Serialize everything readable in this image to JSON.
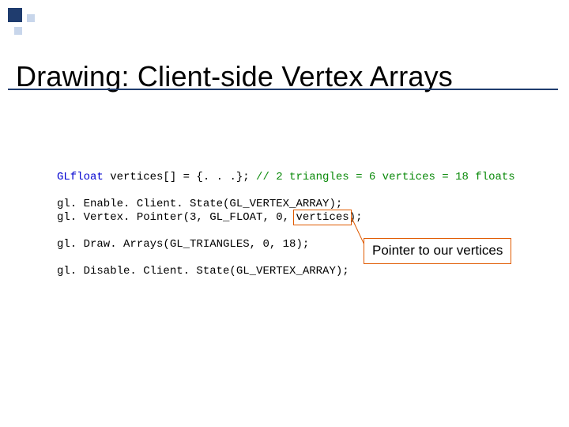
{
  "title": "Drawing:  Client-side Vertex Arrays",
  "code": {
    "l1_kw": "GLfloat",
    "l1_rest": " vertices[] = {. . .}; ",
    "l1_cmt": "// 2 triangles = 6 vertices = 18 floats",
    "l2": "gl. Enable. Client. State(GL_VERTEX_ARRAY);",
    "l3a": "gl. Vertex. Pointer(3, GL_FLOAT, 0, ",
    "l3b": "vertices",
    "l3c": ");",
    "l4": "gl. Draw. Arrays(GL_TRIANGLES, 0, 18);",
    "l5": "gl. Disable. Client. State(GL_VERTEX_ARRAY);"
  },
  "annotation_text": "Pointer to our vertices"
}
